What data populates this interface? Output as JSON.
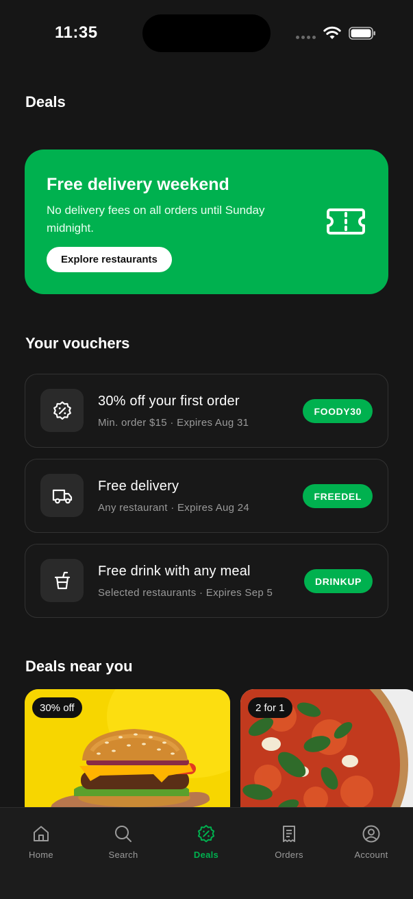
{
  "status_bar": {
    "time": "11:35"
  },
  "page": {
    "title": "Deals"
  },
  "promo": {
    "title": "Free delivery weekend",
    "description": "No delivery fees on all orders until Sunday midnight.",
    "button_label": "Explore restaurants",
    "icon": "ticket-icon",
    "color": "#00b14f"
  },
  "vouchers": {
    "section_title": "Your vouchers",
    "items": [
      {
        "title": "30% off your first order",
        "subtitle": "Min. order $15 · Expires Aug 31",
        "code": "FOODY30",
        "icon": "discount-badge-icon"
      },
      {
        "title": "Free delivery",
        "subtitle": "Any restaurant · Expires Aug 24",
        "code": "FREEDEL",
        "icon": "delivery-truck-icon"
      },
      {
        "title": "Free drink with any meal",
        "subtitle": "Selected restaurants · Expires Sep 5",
        "code": "DRINKUP",
        "icon": "drink-cup-icon"
      }
    ]
  },
  "deals_near_you": {
    "section_title": "Deals near you",
    "cards": [
      {
        "tag": "30% off",
        "image": "burger"
      },
      {
        "tag": "2 for 1",
        "image": "pizza"
      }
    ]
  },
  "tabbar": {
    "tabs": [
      {
        "label": "Home",
        "icon": "home-icon",
        "active": false
      },
      {
        "label": "Search",
        "icon": "search-icon",
        "active": false
      },
      {
        "label": "Deals",
        "icon": "discount-badge-icon",
        "active": true
      },
      {
        "label": "Orders",
        "icon": "receipt-icon",
        "active": false
      },
      {
        "label": "Account",
        "icon": "account-icon",
        "active": false
      }
    ]
  }
}
